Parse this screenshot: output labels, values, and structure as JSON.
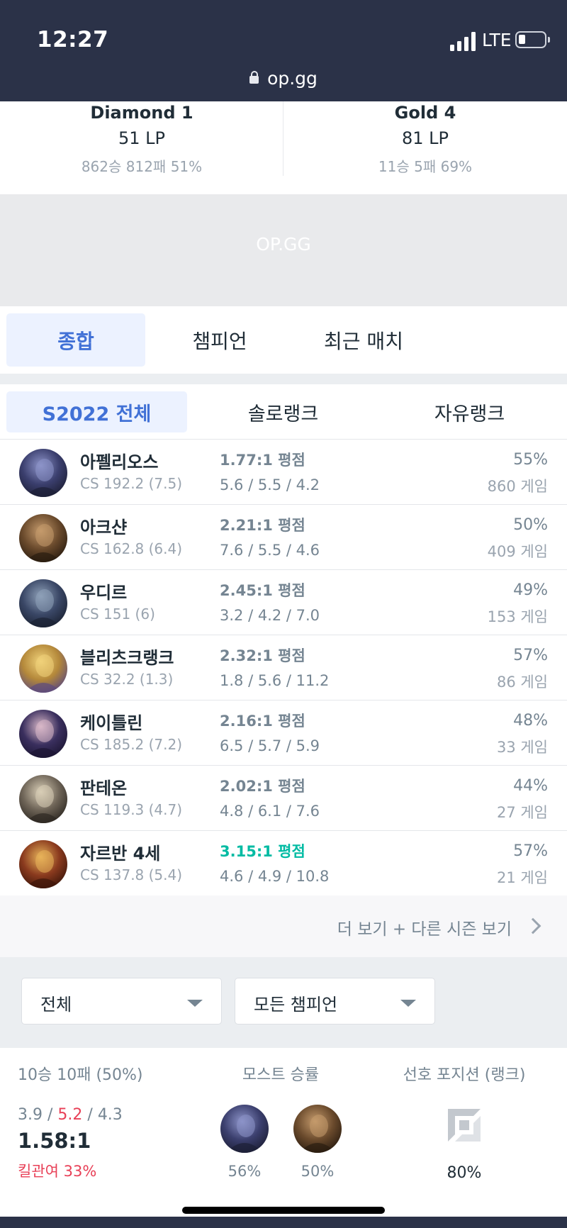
{
  "status_bar": {
    "time": "12:27",
    "network": "LTE",
    "url": "op.gg"
  },
  "ranks": [
    {
      "tier": "Diamond 1",
      "lp": "51 LP",
      "record": "862승 812패 51%"
    },
    {
      "tier": "Gold 4",
      "lp": "81 LP",
      "record": "11승 5패 69%"
    }
  ],
  "ad": {
    "label": "OP.GG"
  },
  "tabs": [
    {
      "label": "종합",
      "active": true
    },
    {
      "label": "챔피언",
      "active": false
    },
    {
      "label": "최근 매치",
      "active": false
    }
  ],
  "season_filters": [
    {
      "label": "S2022 전체",
      "active": true
    },
    {
      "label": "솔로랭크",
      "active": false
    },
    {
      "label": "자유랭크",
      "active": false
    }
  ],
  "champions": [
    {
      "name": "아펠리오스",
      "cs": "CS 192.2 (7.5)",
      "kda_ratio": "1.77:1 평점",
      "kda": "5.6 / 5.5 / 4.2",
      "winrate": "55%",
      "games": "860 게임",
      "highlight": false,
      "avatar_colors": [
        "#3b3f6e",
        "#8d94c9",
        "#1d1f36"
      ]
    },
    {
      "name": "아크샨",
      "cs": "CS 162.8 (6.4)",
      "kda_ratio": "2.21:1 평점",
      "kda": "7.6 / 5.5 / 4.6",
      "winrate": "50%",
      "games": "409 게임",
      "highlight": false,
      "avatar_colors": [
        "#6a4a2c",
        "#c49a6c",
        "#2a1c10"
      ]
    },
    {
      "name": "우디르",
      "cs": "CS 151 (6)",
      "kda_ratio": "2.45:1 평점",
      "kda": "3.2 / 4.2 / 7.0",
      "winrate": "49%",
      "games": "153 게임",
      "highlight": false,
      "avatar_colors": [
        "#3a4766",
        "#8ea0b8",
        "#1b2233"
      ]
    },
    {
      "name": "블리츠크랭크",
      "cs": "CS 32.2 (1.3)",
      "kda_ratio": "2.32:1 평점",
      "kda": "1.8 / 5.6 / 11.2",
      "winrate": "57%",
      "games": "86 게임",
      "highlight": false,
      "avatar_colors": [
        "#b4883a",
        "#f0d27a",
        "#5c4a7d"
      ]
    },
    {
      "name": "케이틀린",
      "cs": "CS 185.2 (7.2)",
      "kda_ratio": "2.16:1 평점",
      "kda": "6.5 / 5.7 / 5.9",
      "winrate": "48%",
      "games": "33 게임",
      "highlight": false,
      "avatar_colors": [
        "#3a2f5e",
        "#d9b8c8",
        "#1c1633"
      ]
    },
    {
      "name": "판테온",
      "cs": "CS 119.3 (4.7)",
      "kda_ratio": "2.02:1 평점",
      "kda": "4.8 / 6.1 / 7.6",
      "winrate": "44%",
      "games": "27 게임",
      "highlight": false,
      "avatar_colors": [
        "#6e6457",
        "#d8cdb6",
        "#2d2822"
      ]
    },
    {
      "name": "자르반 4세",
      "cs": "CS 137.8 (5.4)",
      "kda_ratio": "3.15:1 평점",
      "kda": "4.6 / 4.9 / 10.8",
      "winrate": "57%",
      "games": "21 게임",
      "highlight": true,
      "avatar_colors": [
        "#8a3a1e",
        "#e7b35a",
        "#3d160a"
      ]
    }
  ],
  "more": {
    "label": "더 보기 + 다른 시즌 보기"
  },
  "selects": {
    "queue": "전체",
    "champion": "모든 챔피언"
  },
  "summary": {
    "record": "10승 10패 (50%)",
    "kill": "3.9",
    "death": "5.2",
    "assist": "4.3",
    "ratio": "1.58:1",
    "kill_participation": "킬관여 33%",
    "most_title": "모스트 승률",
    "most": [
      {
        "winrate": "56%",
        "avatar_colors": [
          "#3b3f6e",
          "#8d94c9",
          "#1d1f36"
        ]
      },
      {
        "winrate": "50%",
        "avatar_colors": [
          "#6a4a2c",
          "#c49a6c",
          "#2a1c10"
        ]
      }
    ],
    "position_title": "선호 포지션 (랭크)",
    "position_pct": "80%"
  },
  "colors": {
    "header_bg": "#2b3248",
    "accent": "#4171d6",
    "good_kda": "#00bba3",
    "loss_red": "#e84057"
  }
}
